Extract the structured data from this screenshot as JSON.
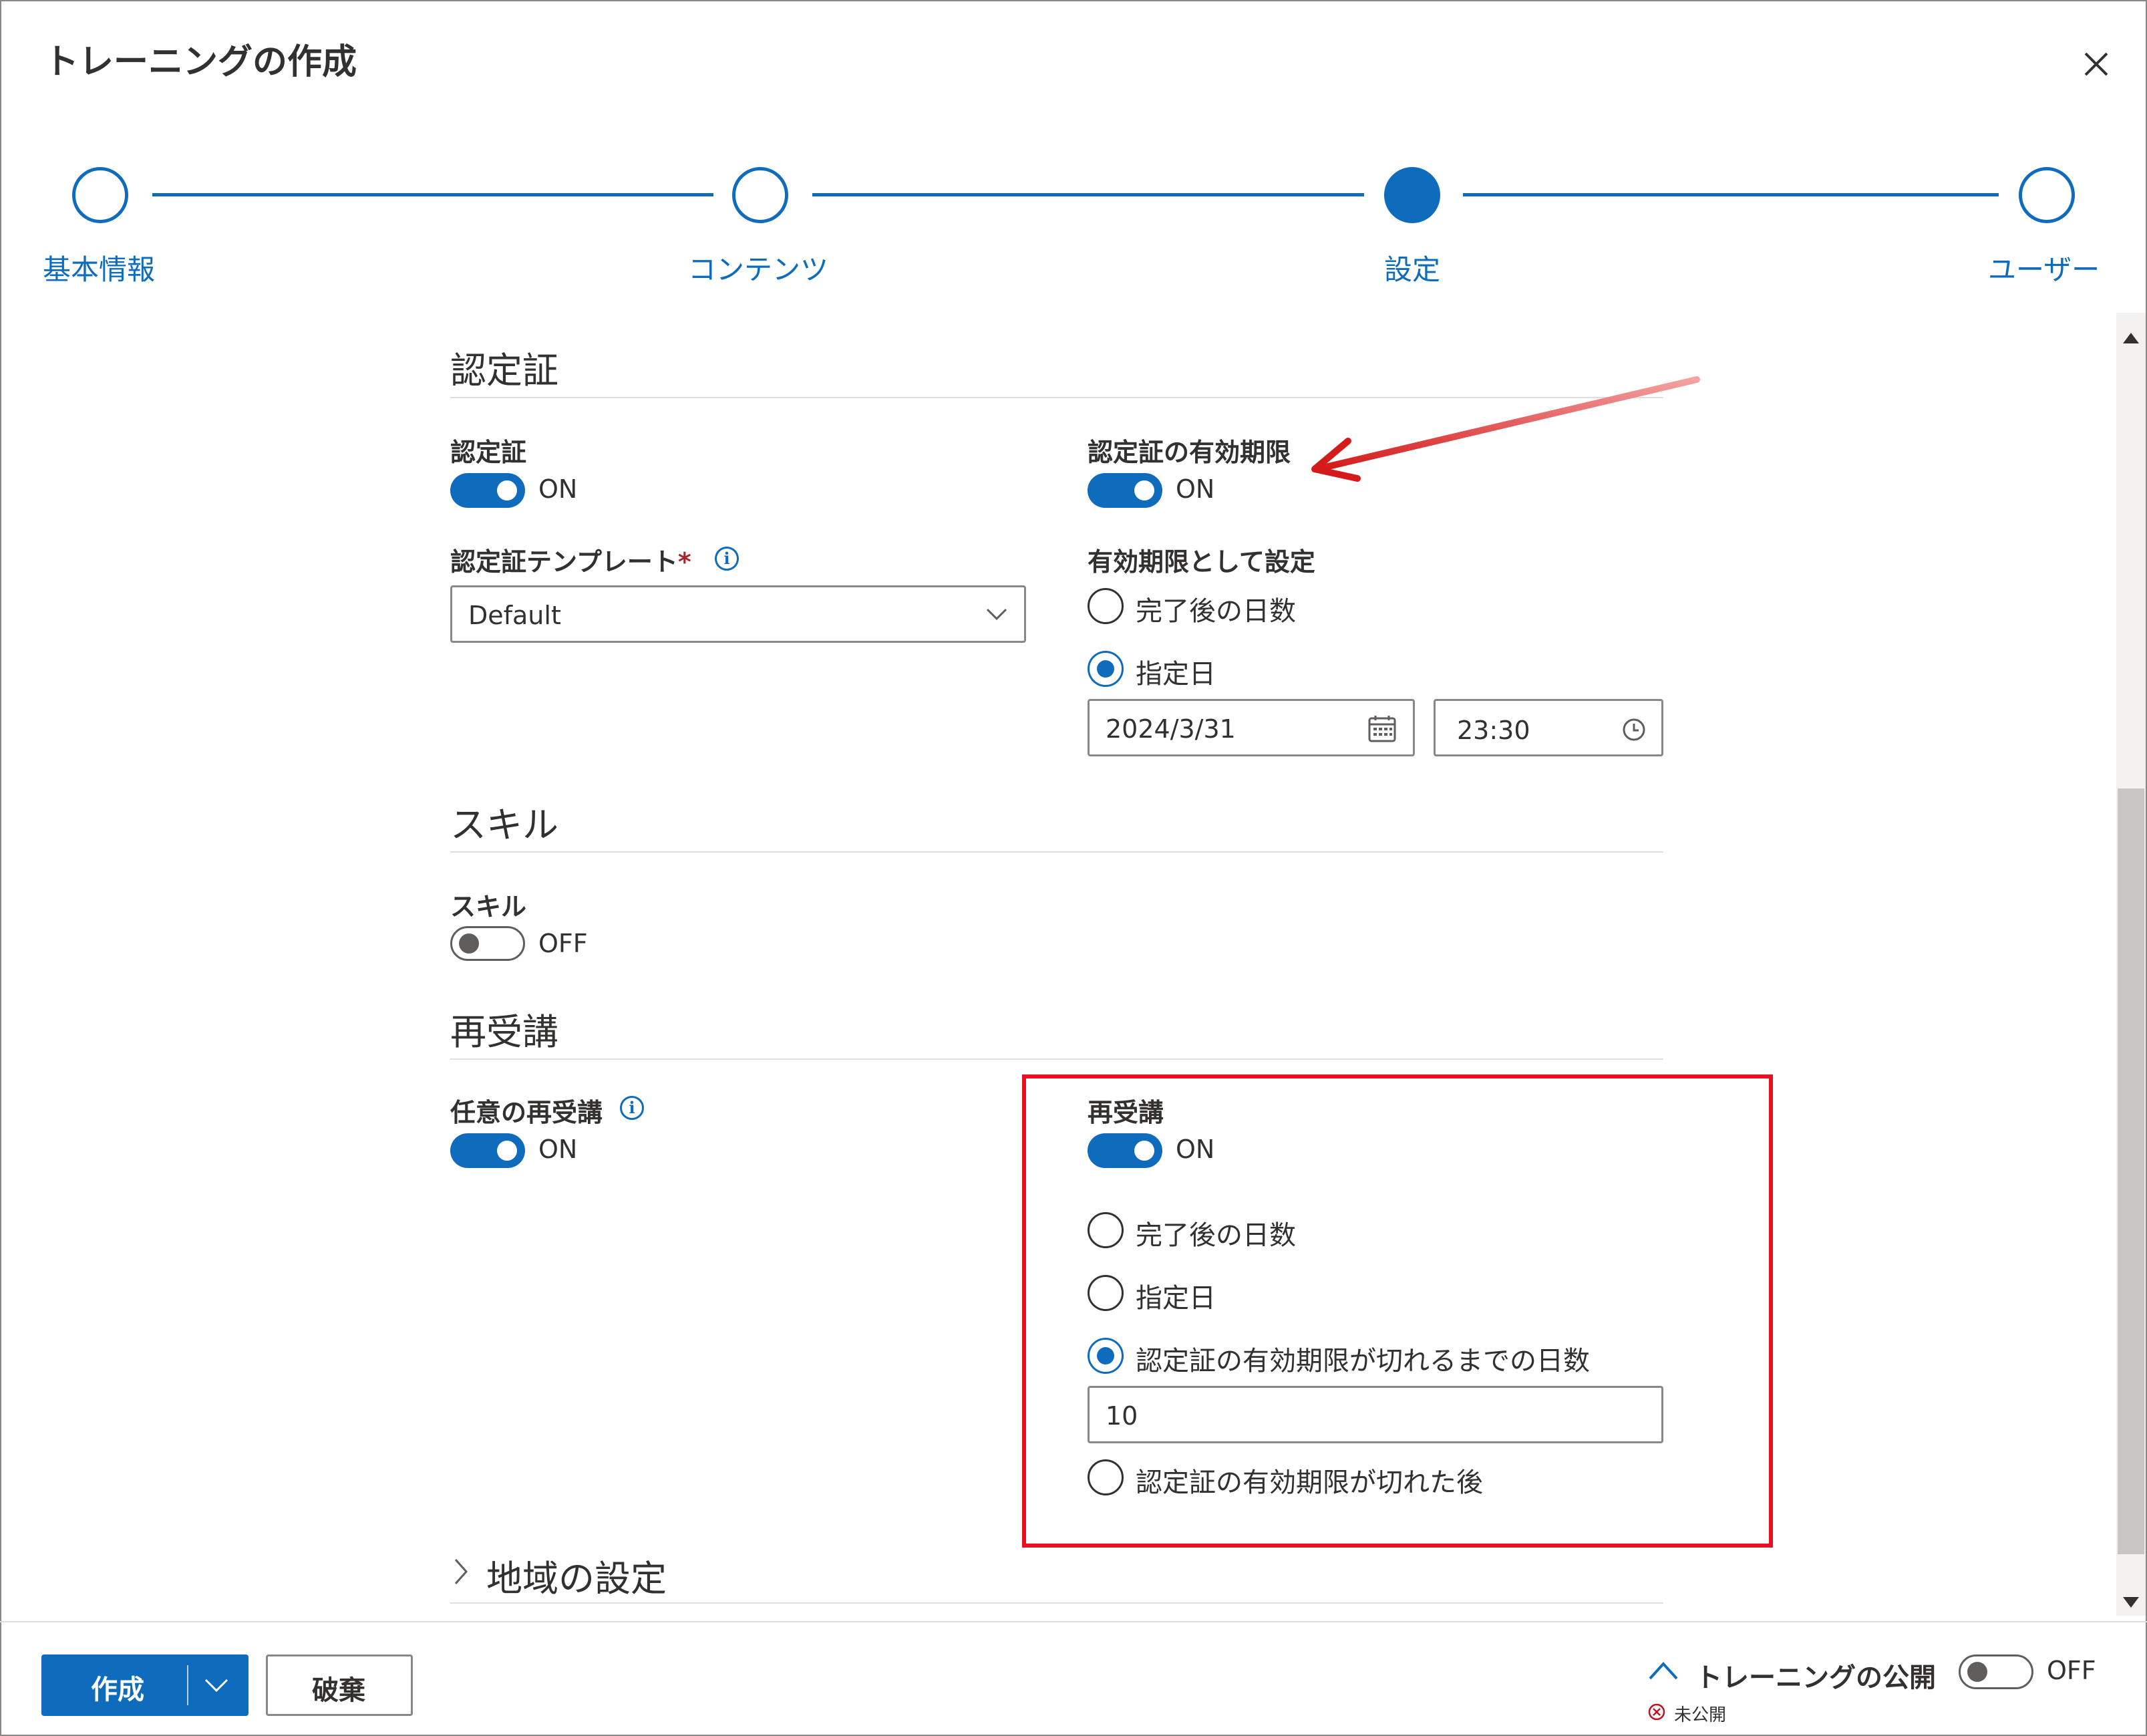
{
  "dialog": {
    "title": "トレーニングの作成"
  },
  "stepper": {
    "steps": [
      {
        "label": "基本情報",
        "state": "incomplete"
      },
      {
        "label": "コンテンツ",
        "state": "incomplete"
      },
      {
        "label": "設定",
        "state": "current"
      },
      {
        "label": "ユーザー",
        "state": "incomplete"
      }
    ]
  },
  "certificate": {
    "section_title": "認定証",
    "toggle_label": "認定証",
    "toggle_state": "ON",
    "template_label": "認定証テンプレート",
    "template_required_mark": "*",
    "template_value": "Default",
    "expiry_label": "認定証の有効期限",
    "expiry_state": "ON",
    "set_expiry_label": "有効期限として設定",
    "option_days_after": "完了後の日数",
    "option_specific_date": "指定日",
    "date_value": "2024/3/31",
    "time_value": "23:30"
  },
  "skill": {
    "section_title": "スキル",
    "toggle_label": "スキル",
    "toggle_state": "OFF"
  },
  "retake": {
    "section_title": "再受講",
    "optional_label": "任意の再受講",
    "optional_state": "ON",
    "retake_label": "再受講",
    "retake_state": "ON",
    "option_days_after": "完了後の日数",
    "option_specific_date": "指定日",
    "option_days_before_expiry": "認定証の有効期限が切れるまでの日数",
    "days_value": "10",
    "option_after_expiry": "認定証の有効期限が切れた後"
  },
  "region": {
    "section_title": "地域の設定"
  },
  "footer": {
    "create_label": "作成",
    "discard_label": "破棄",
    "publish_label": "トレーニングの公開",
    "publish_state": "OFF",
    "publish_status": "未公開"
  },
  "colors": {
    "accent": "#0f6cbd",
    "annotation_red": "#e81123"
  }
}
